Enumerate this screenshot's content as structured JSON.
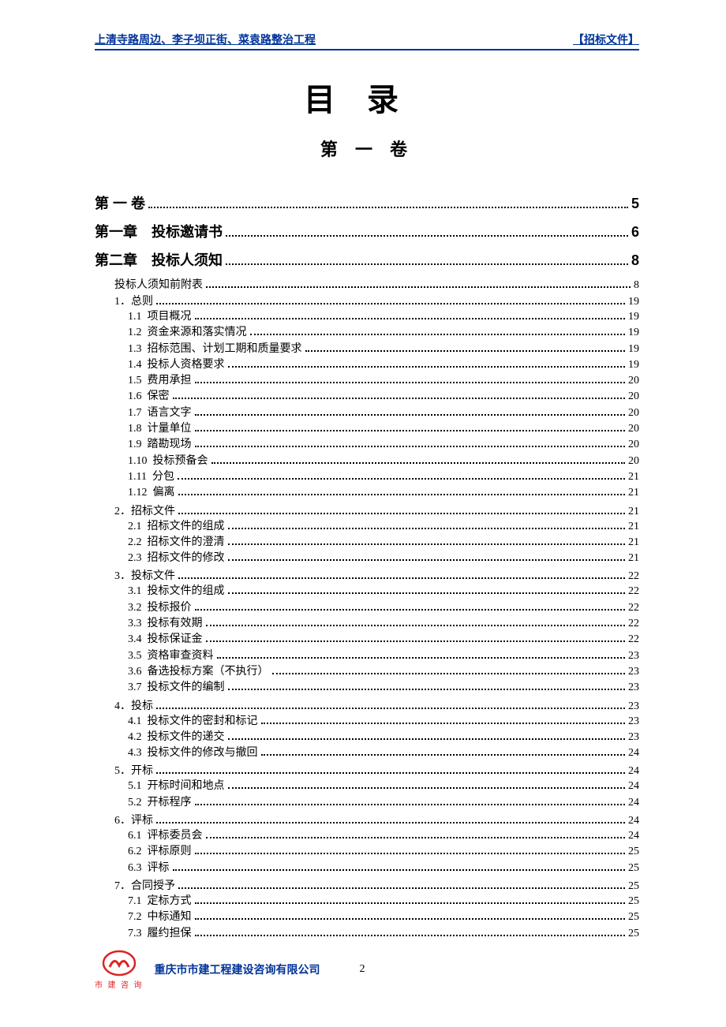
{
  "header": {
    "left": "上清寺路周边、李子坝正街、菜袁路整治工程",
    "right": "【招标文件】"
  },
  "title": "目录",
  "subtitle": "第 一 卷",
  "toc": [
    {
      "level": 1,
      "num": "第 一 卷",
      "label": "",
      "page": "5"
    },
    {
      "level": 1,
      "num": "第一章",
      "label": "投标邀请书",
      "page": "6"
    },
    {
      "level": 1,
      "num": "第二章",
      "label": "投标人须知",
      "page": "8"
    },
    {
      "level": 2,
      "num": "",
      "label": "投标人须知前附表",
      "page": "8"
    },
    {
      "level": 2,
      "num": "1．",
      "label": "总则",
      "page": "19"
    },
    {
      "level": 3,
      "num": "1.1",
      "label": "项目概况",
      "page": "19"
    },
    {
      "level": 3,
      "num": "1.2",
      "label": "资金来源和落实情况",
      "page": "19"
    },
    {
      "level": 3,
      "num": "1.3",
      "label": "招标范围、计划工期和质量要求",
      "page": "19"
    },
    {
      "level": 3,
      "num": "1.4",
      "label": "投标人资格要求",
      "page": "19"
    },
    {
      "level": 3,
      "num": "1.5",
      "label": "费用承担",
      "page": "20"
    },
    {
      "level": 3,
      "num": "1.6",
      "label": "保密",
      "page": "20"
    },
    {
      "level": 3,
      "num": "1.7",
      "label": "语言文字",
      "page": "20"
    },
    {
      "level": 3,
      "num": "1.8",
      "label": "计量单位",
      "page": "20"
    },
    {
      "level": 3,
      "num": "1.9",
      "label": "踏勘现场",
      "page": "20"
    },
    {
      "level": 3,
      "num": "1.10",
      "label": "投标预备会",
      "page": "20"
    },
    {
      "level": 3,
      "num": "1.11",
      "label": "分包",
      "page": "21"
    },
    {
      "level": 3,
      "num": "1.12",
      "label": "偏离",
      "page": "21"
    },
    {
      "level": 2,
      "num": "2．",
      "label": "招标文件",
      "page": "21"
    },
    {
      "level": 3,
      "num": "2.1",
      "label": "招标文件的组成",
      "page": "21"
    },
    {
      "level": 3,
      "num": "2.2",
      "label": "招标文件的澄清",
      "page": "21"
    },
    {
      "level": 3,
      "num": "2.3",
      "label": "招标文件的修改",
      "page": "21"
    },
    {
      "level": 2,
      "num": "3．",
      "label": "投标文件",
      "page": "22"
    },
    {
      "level": 3,
      "num": "3.1",
      "label": "投标文件的组成",
      "page": "22"
    },
    {
      "level": 3,
      "num": "3.2",
      "label": "投标报价",
      "page": "22"
    },
    {
      "level": 3,
      "num": "3.3",
      "label": "投标有效期",
      "page": "22"
    },
    {
      "level": 3,
      "num": "3.4",
      "label": "投标保证金",
      "page": "22"
    },
    {
      "level": 3,
      "num": "3.5",
      "label": "资格审查资料",
      "page": "23"
    },
    {
      "level": 3,
      "num": "3.6",
      "label": "备选投标方案（不执行）",
      "page": "23"
    },
    {
      "level": 3,
      "num": "3.7",
      "label": "投标文件的编制",
      "page": "23"
    },
    {
      "level": 2,
      "num": "4．",
      "label": "投标",
      "page": "23"
    },
    {
      "level": 3,
      "num": "4.1",
      "label": "投标文件的密封和标记",
      "page": "23"
    },
    {
      "level": 3,
      "num": "4.2",
      "label": "投标文件的递交",
      "page": "23"
    },
    {
      "level": 3,
      "num": "4.3",
      "label": "投标文件的修改与撤回",
      "page": "24"
    },
    {
      "level": 2,
      "num": "5．",
      "label": "开标",
      "page": "24"
    },
    {
      "level": 3,
      "num": "5.1",
      "label": "开标时间和地点",
      "page": "24"
    },
    {
      "level": 3,
      "num": "5.2",
      "label": "开标程序",
      "page": "24"
    },
    {
      "level": 2,
      "num": "6．",
      "label": "评标",
      "page": "24"
    },
    {
      "level": 3,
      "num": "6.1",
      "label": "评标委员会",
      "page": "24"
    },
    {
      "level": 3,
      "num": "6.2",
      "label": "评标原则",
      "page": "25"
    },
    {
      "level": 3,
      "num": "6.3",
      "label": "评标",
      "page": "25"
    },
    {
      "level": 2,
      "num": "7．",
      "label": "合同授予",
      "page": "25"
    },
    {
      "level": 3,
      "num": "7.1",
      "label": "定标方式",
      "page": "25"
    },
    {
      "level": 3,
      "num": "7.2",
      "label": "中标通知",
      "page": "25"
    },
    {
      "level": 3,
      "num": "7.3",
      "label": "履约担保",
      "page": "25"
    }
  ],
  "footer": {
    "logo_text": "市 建 咨 询",
    "company": "重庆市市建工程建设咨询有限公司",
    "page": "2"
  }
}
